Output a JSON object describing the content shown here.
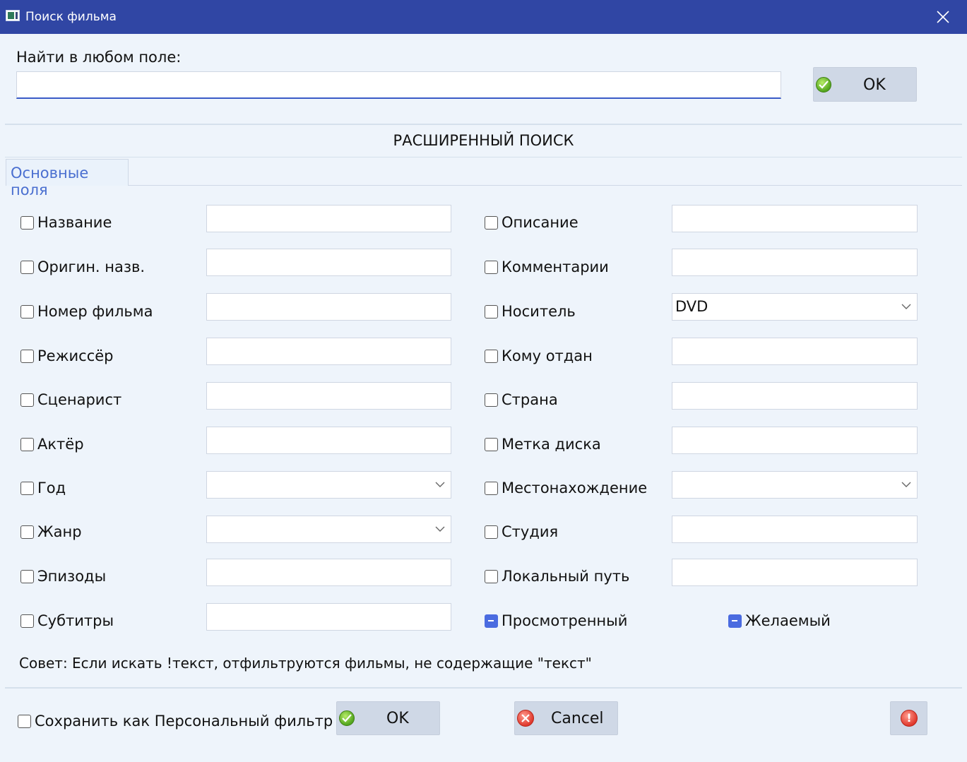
{
  "window": {
    "title": "Поиск фильма"
  },
  "quick_search": {
    "label": "Найти в любом поле:",
    "value": "",
    "ok_label": "OK"
  },
  "advanced": {
    "section_title": "РАСШИРЕННЫЙ ПОИСК",
    "tab_label": "Основные поля"
  },
  "left_fields": [
    {
      "label": "Название",
      "kind": "text",
      "value": ""
    },
    {
      "label": "Оригин. назв.",
      "kind": "text",
      "value": ""
    },
    {
      "label": "Номер фильма",
      "kind": "text",
      "value": ""
    },
    {
      "label": "Режиссёр",
      "kind": "text",
      "value": ""
    },
    {
      "label": "Сценарист",
      "kind": "text",
      "value": ""
    },
    {
      "label": "Актёр",
      "kind": "text",
      "value": ""
    },
    {
      "label": "Год",
      "kind": "combo",
      "value": ""
    },
    {
      "label": "Жанр",
      "kind": "combo",
      "value": ""
    },
    {
      "label": "Эпизоды",
      "kind": "text",
      "value": ""
    },
    {
      "label": "Субтитры",
      "kind": "text",
      "value": ""
    }
  ],
  "right_fields": [
    {
      "label": "Описание",
      "kind": "text",
      "value": ""
    },
    {
      "label": "Комментарии",
      "kind": "text",
      "value": ""
    },
    {
      "label": "Носитель",
      "kind": "combo",
      "value": "DVD"
    },
    {
      "label": "Кому отдан",
      "kind": "text",
      "value": ""
    },
    {
      "label": "Страна",
      "kind": "text",
      "value": ""
    },
    {
      "label": "Метка диска",
      "kind": "text",
      "value": ""
    },
    {
      "label": "Местонахождение",
      "kind": "combo",
      "value": ""
    },
    {
      "label": "Студия",
      "kind": "text",
      "value": ""
    },
    {
      "label": "Локальный путь",
      "kind": "text",
      "value": ""
    }
  ],
  "tristate": [
    {
      "label": "Просмотренный",
      "state": "indeterminate"
    },
    {
      "label": "Желаемый",
      "state": "indeterminate"
    }
  ],
  "tip": "Совет: Если искать !текст, отфильтруются фильмы, не содержащие \"текст\"",
  "footer": {
    "save_filter_label": "Сохранить как Персональный фильтр",
    "ok_label": "OK",
    "cancel_label": "Cancel"
  },
  "colors": {
    "titlebar": "#3046a4",
    "accent": "#4a6be0",
    "background": "#eef4fb"
  }
}
